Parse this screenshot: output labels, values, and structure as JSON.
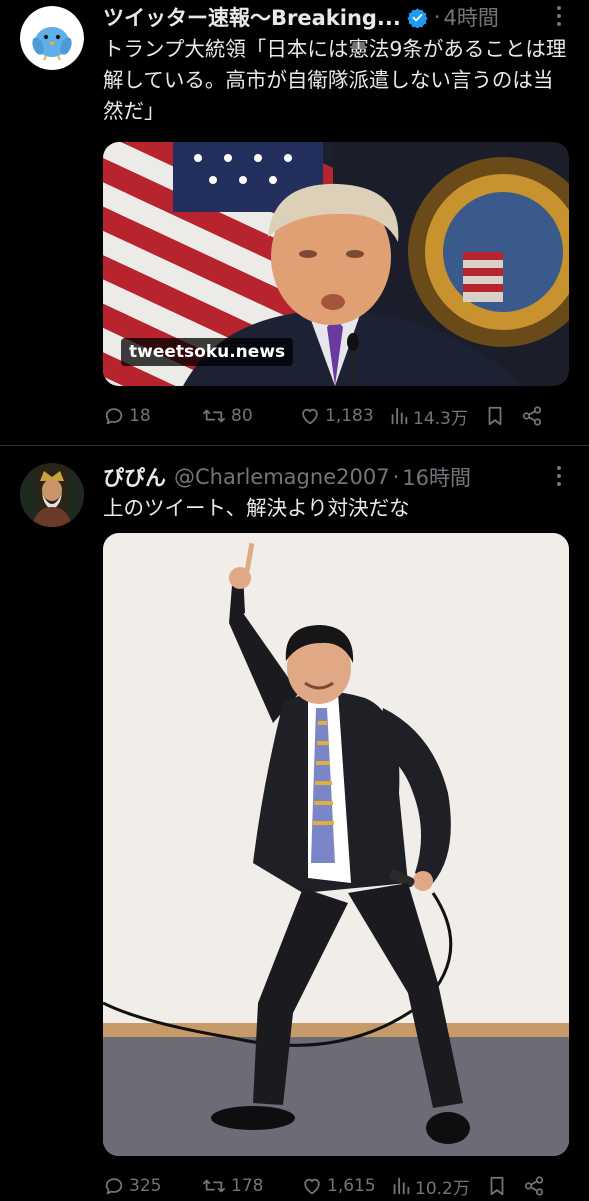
{
  "tweet1": {
    "author_name": "ツイッター速報〜Breaking...",
    "time": "4時間",
    "text": "トランプ大統領「日本には憲法9条があることは理解している。高市が自衛隊派遣しない言うのは当然だ」",
    "watermark": "tweetsoku.news",
    "replies": "18",
    "retweets": "80",
    "likes": "1,183",
    "views": "14.3万"
  },
  "tweet2": {
    "author_name": "ぴぴん",
    "handle": "@Charlemagne2007",
    "time": "16時間",
    "text": "上のツイート、解決より対決だな",
    "replies": "325",
    "retweets": "178",
    "likes": "1,615",
    "views": "10.2万"
  },
  "separator": "·",
  "colors": {
    "background": "#000000",
    "text": "#e7e9ea",
    "muted": "#71767b",
    "verified": "#1d9bf0",
    "divider": "#2f3336"
  },
  "icons": [
    "reply-icon",
    "retweet-icon",
    "like-icon",
    "views-icon",
    "bookmark-icon",
    "share-icon",
    "verified-badge-icon",
    "more-icon"
  ]
}
